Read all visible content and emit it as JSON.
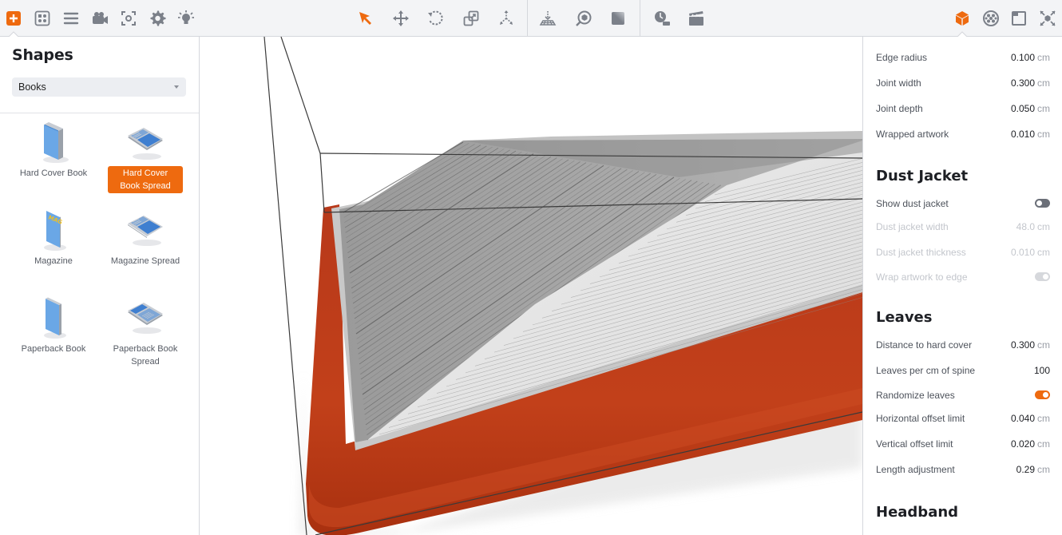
{
  "toolbar": {
    "left_icons": [
      "add-shape-icon",
      "layout-grid-icon",
      "list-icon",
      "camera-icon",
      "focus-icon",
      "settings-gear-icon",
      "light-icon"
    ],
    "center_icons": [
      "select-arrow-icon",
      "move-icon",
      "rotate-icon",
      "scale-icon",
      "pivot-icon"
    ],
    "center2_icons": [
      "drop-to-floor-icon",
      "inspect-object-icon",
      "material-icon"
    ],
    "center3_icons": [
      "time-of-day-icon",
      "animation-clapper-icon"
    ],
    "right_icons": [
      "object-properties-icon",
      "texture-ball-icon",
      "frame-icon",
      "fit-view-icon"
    ],
    "active_left": "add-shape-icon",
    "active_tool": "select-arrow-icon",
    "active_right": "object-properties-icon",
    "accent_color": "#ee6a0f",
    "icon_color": "#7b8089"
  },
  "shapes_panel": {
    "title": "Shapes",
    "category": "Books",
    "items": [
      {
        "label": "Hard Cover Book",
        "active": false
      },
      {
        "label": "Hard Cover Book Spread",
        "active": true
      },
      {
        "label": "Magazine",
        "active": false
      },
      {
        "label": "Magazine Spread",
        "active": false
      },
      {
        "label": "Paperback Book",
        "active": false
      },
      {
        "label": "Paperback Book Spread",
        "active": false
      }
    ],
    "magazine_cover_text": "MAG"
  },
  "properties": {
    "cover": [
      {
        "name": "Edge radius",
        "value": "0.100",
        "unit": "cm"
      },
      {
        "name": "Joint width",
        "value": "0.300",
        "unit": "cm"
      },
      {
        "name": "Joint depth",
        "value": "0.050",
        "unit": "cm"
      },
      {
        "name": "Wrapped artwork",
        "value": "0.010",
        "unit": "cm"
      }
    ],
    "dust_jacket": {
      "title": "Dust Jacket",
      "show_label": "Show dust jacket",
      "show": false,
      "width_label": "Dust jacket width",
      "width_value": "48.0",
      "width_unit": "cm",
      "thickness_label": "Dust jacket thickness",
      "thickness_value": "0.010",
      "thickness_unit": "cm",
      "wrap_label": "Wrap artwork to edge",
      "wrap": true
    },
    "leaves": {
      "title": "Leaves",
      "distance_label": "Distance to hard cover",
      "distance_value": "0.300",
      "distance_unit": "cm",
      "per_cm_label": "Leaves per cm of spine",
      "per_cm_value": "100",
      "randomize_label": "Randomize leaves",
      "randomize": true,
      "h_offset_label": "Horizontal offset limit",
      "h_offset_value": "0.040",
      "h_offset_unit": "cm",
      "v_offset_label": "Vertical offset limit",
      "v_offset_value": "0.020",
      "v_offset_unit": "cm",
      "length_label": "Length adjustment",
      "length_value": "0.29",
      "length_unit": "cm"
    },
    "headband": {
      "title": "Headband"
    }
  },
  "viewport": {
    "cover_color": "#c23a14",
    "page_color": "#d8d8d8"
  }
}
